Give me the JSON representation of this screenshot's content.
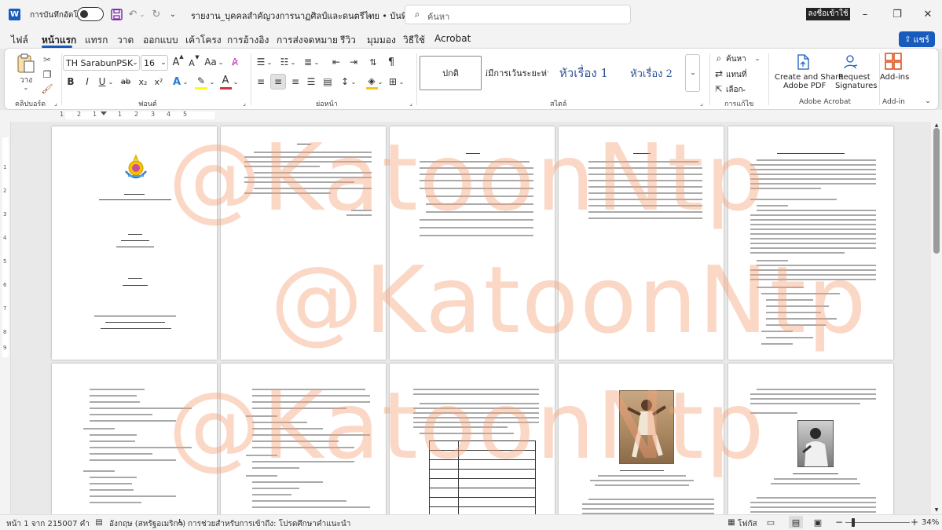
{
  "titlebar": {
    "autosave_label": "การบันทึกอัตโนมัติ",
    "document_title": "รายงาน_บุคคลสำคัญวงการนาฏศิลป์และดนตรีไทย • บันทึกแล้ว",
    "search_placeholder": "ค้นหา",
    "signin_label": "ลงชื่อเข้าใช้"
  },
  "menu": {
    "tabs": [
      "ไฟล์",
      "หน้าแรก",
      "แทรก",
      "วาด",
      "ออกแบบ",
      "เค้าโครง",
      "การอ้างอิง",
      "การส่งจดหมาย",
      "รีวิว",
      "มุมมอง",
      "วิธีใช้",
      "Acrobat"
    ],
    "active_tab": "หน้าแรก",
    "share_label": "แชร์"
  },
  "ribbon": {
    "paste_label": "วาง",
    "clipboard_label": "คลิปบอร์ด",
    "font_name": "TH SarabunPSK",
    "font_size": "16",
    "font_group_label": "ฟอนต์",
    "paragraph_group_label": "ย่อหน้า",
    "styles_group_label": "สไตล์",
    "styles": [
      "ปกติ",
      "ไม่มีการเว้นระยะห่าง",
      "หัวเรื่อง 1",
      "หัวเรื่อง 2"
    ],
    "find_label": "ค้นหา",
    "replace_label": "แทนที่",
    "select_label": "เลือก",
    "editing_label": "การแก้ไข",
    "create_share_pdf_line1": "Create and Share",
    "create_share_pdf_line2": "Adobe PDF",
    "request_signatures_line1": "Request",
    "request_signatures_line2": "Signatures",
    "acrobat_group_label": "Adobe Acrobat",
    "addins_label": "Add-ins",
    "addins_group_label": "Add-in",
    "font_size_grow": "A",
    "font_size_shrink": "A",
    "change_case": "Aa",
    "bold": "B",
    "italic": "I",
    "underline": "U",
    "strike": "ab",
    "subscript": "x₂",
    "superscript": "x²",
    "font_color_a": "A"
  },
  "ruler_marks": [
    "1",
    "2",
    "1",
    "1",
    "2",
    "3",
    "4",
    "5"
  ],
  "vruler_marks": [
    "1",
    "2",
    "3",
    "4",
    "5",
    "6",
    "7",
    "8",
    "9"
  ],
  "watermark": "@KatoonNtp",
  "statusbar": {
    "page_info": "หน้า 1 จาก 21",
    "word_count": "5007 คำ",
    "language": "อังกฤษ (สหรัฐอเมริกา)",
    "accessibility": "การช่วยสำหรับการเข้าถึง: โปรดศึกษาคำแนะนำ",
    "focus_label": "โฟกัส",
    "zoom": "34%"
  },
  "colors": {
    "accent": "#185abd",
    "highlight": "#ffff00",
    "font_color": "#d13438",
    "watermark": "#f5a078",
    "shading": "#f2c811"
  }
}
